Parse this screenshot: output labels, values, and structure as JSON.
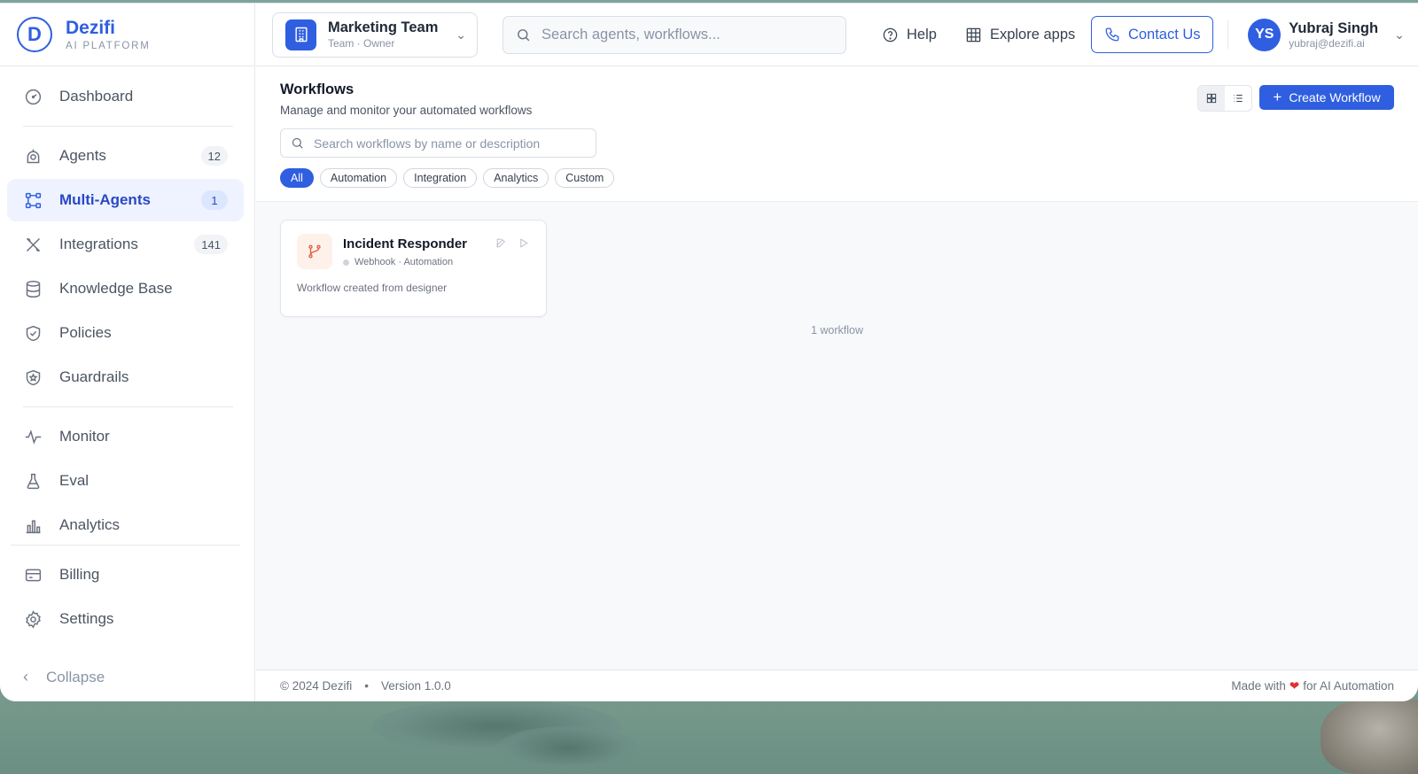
{
  "brand": {
    "name": "Dezifi",
    "subtitle": "AI PLATFORM",
    "logo_letter": "D",
    "color": "#2f5fe0"
  },
  "sidebar": {
    "items": [
      {
        "label": "Dashboard",
        "icon": "gauge-icon",
        "badge": ""
      },
      {
        "label": "Agents",
        "icon": "bot-icon",
        "badge": "12"
      },
      {
        "label": "Multi-Agents",
        "icon": "workflow-icon",
        "badge": "1",
        "active": true
      },
      {
        "label": "Integrations",
        "icon": "tools-icon",
        "badge": "141"
      },
      {
        "label": "Knowledge Base",
        "icon": "database-icon",
        "badge": ""
      },
      {
        "label": "Policies",
        "icon": "shield-check-icon",
        "badge": ""
      },
      {
        "label": "Guardrails",
        "icon": "shield-star-icon",
        "badge": ""
      },
      {
        "label": "Monitor",
        "icon": "activity-icon",
        "badge": ""
      },
      {
        "label": "Eval",
        "icon": "flask-icon",
        "badge": ""
      },
      {
        "label": "Analytics",
        "icon": "bar-chart-icon",
        "badge": ""
      },
      {
        "label": "Billing",
        "icon": "card-icon",
        "badge": ""
      },
      {
        "label": "Settings",
        "icon": "gear-icon",
        "badge": ""
      }
    ],
    "collapse_label": "Collapse"
  },
  "topbar": {
    "team": {
      "name": "Marketing Team",
      "role": "Team · Owner"
    },
    "search_placeholder": "Search agents, workflows...",
    "help_label": "Help",
    "explore_label": "Explore apps",
    "contact_label": "Contact Us",
    "user": {
      "initials": "YS",
      "name": "Yubraj Singh",
      "email": "yubraj@dezifi.ai"
    }
  },
  "page": {
    "title": "Workflows",
    "subtitle": "Manage and monitor your automated workflows",
    "search_placeholder": "Search workflows by name or description",
    "filters": [
      "All",
      "Automation",
      "Integration",
      "Analytics",
      "Custom"
    ],
    "active_filter": "All",
    "create_label": "Create Workflow",
    "view_mode": "grid"
  },
  "workflows": [
    {
      "name": "Incident Responder",
      "trigger": "Webhook",
      "category": "Automation",
      "meta": "Webhook · Automation",
      "description": "Workflow created from designer",
      "icon": "git-branch-icon"
    }
  ],
  "workflow_count_label": "1 workflow",
  "footer": {
    "copyright": "© 2024 Dezifi",
    "version": "Version 1.0.0",
    "made_with_prefix": "Made with",
    "made_with_suffix": "for AI Automation"
  }
}
